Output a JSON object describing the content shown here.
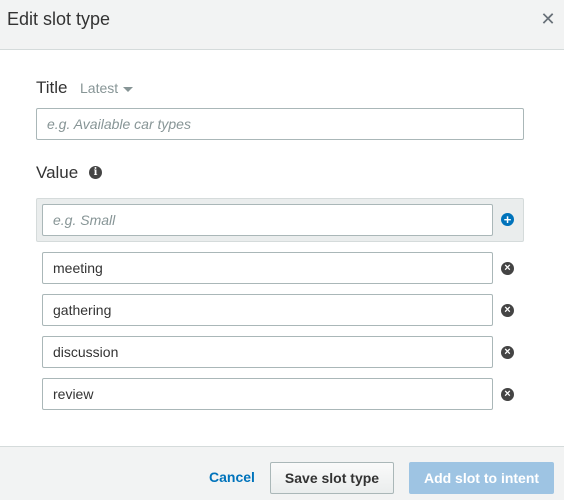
{
  "dialog": {
    "title": "Edit slot type",
    "close_icon": "close-icon"
  },
  "title_section": {
    "label": "Title",
    "version_label": "Latest",
    "placeholder": "e.g. Available car types",
    "value": ""
  },
  "value_section": {
    "label": "Value",
    "info_icon": "info-icon",
    "new_value_placeholder": "e.g. Small",
    "add_icon": "plus-circle-icon",
    "remove_icon": "x-circle-icon",
    "values": [
      "meeting",
      "gathering",
      "discussion",
      "review"
    ]
  },
  "footer": {
    "cancel_label": "Cancel",
    "save_label": "Save slot type",
    "add_label": "Add slot to intent"
  },
  "colors": {
    "link": "#0073bb",
    "primary_disabled": "#9ec4e3",
    "header_bg": "#f2f3f3"
  }
}
